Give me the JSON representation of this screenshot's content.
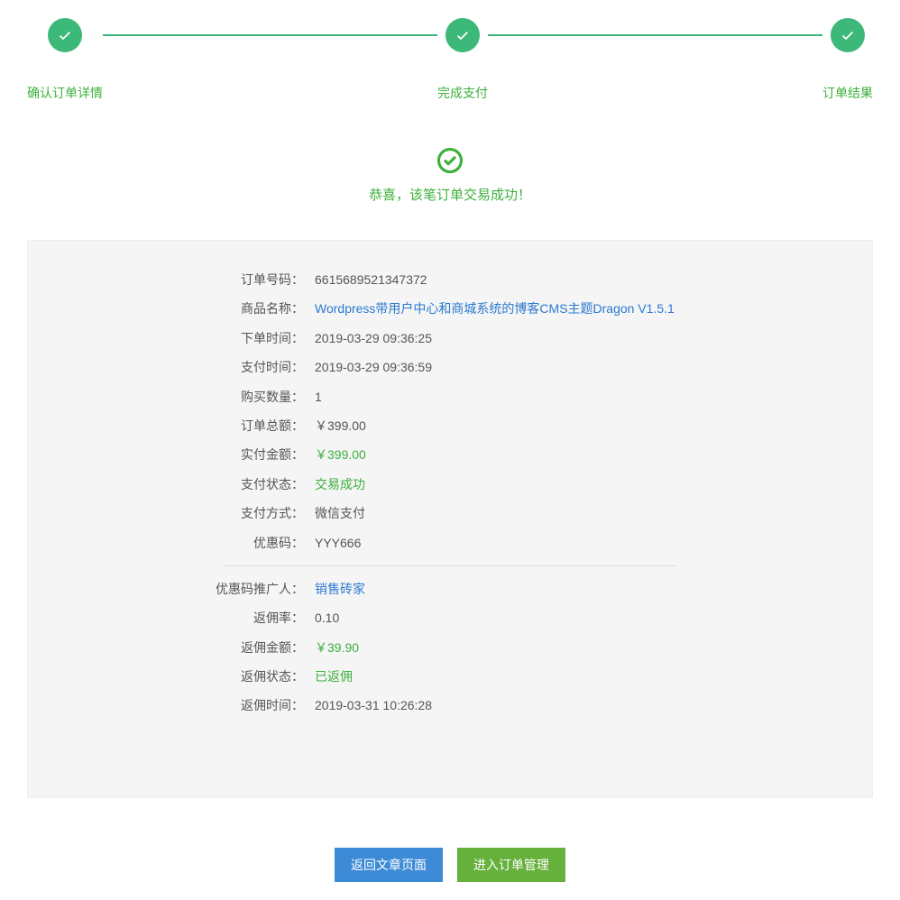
{
  "steps": [
    {
      "label": "确认订单详情"
    },
    {
      "label": "完成支付"
    },
    {
      "label": "订单结果"
    }
  ],
  "success_message": "恭喜，该笔订单交易成功！",
  "order": {
    "number_label": "订单号码：",
    "number": "6615689521347372",
    "product_label": "商品名称：",
    "product": "Wordpress带用户中心和商城系统的博客CMS主题Dragon V1.5.1",
    "order_time_label": "下单时间：",
    "order_time": "2019-03-29 09:36:25",
    "pay_time_label": "支付时间：",
    "pay_time": "2019-03-29 09:36:59",
    "qty_label": "购买数量：",
    "qty": "1",
    "total_label": "订单总额：",
    "total": "￥399.00",
    "paid_label": "实付金额：",
    "paid": "￥399.00",
    "pay_status_label": "支付状态：",
    "pay_status": "交易成功",
    "pay_method_label": "支付方式：",
    "pay_method": "微信支付",
    "coupon_label": "优惠码：",
    "coupon": "YYY666"
  },
  "rebate": {
    "referrer_label": "优惠码推广人：",
    "referrer": "销售砖家",
    "rate_label": "返佣率：",
    "rate": "0.10",
    "amount_label": "返佣金额：",
    "amount": "￥39.90",
    "status_label": "返佣状态：",
    "status": "已返佣",
    "time_label": "返佣时间：",
    "time": "2019-03-31 10:26:28"
  },
  "actions": {
    "back": "返回文章页面",
    "manage": "进入订单管理"
  }
}
